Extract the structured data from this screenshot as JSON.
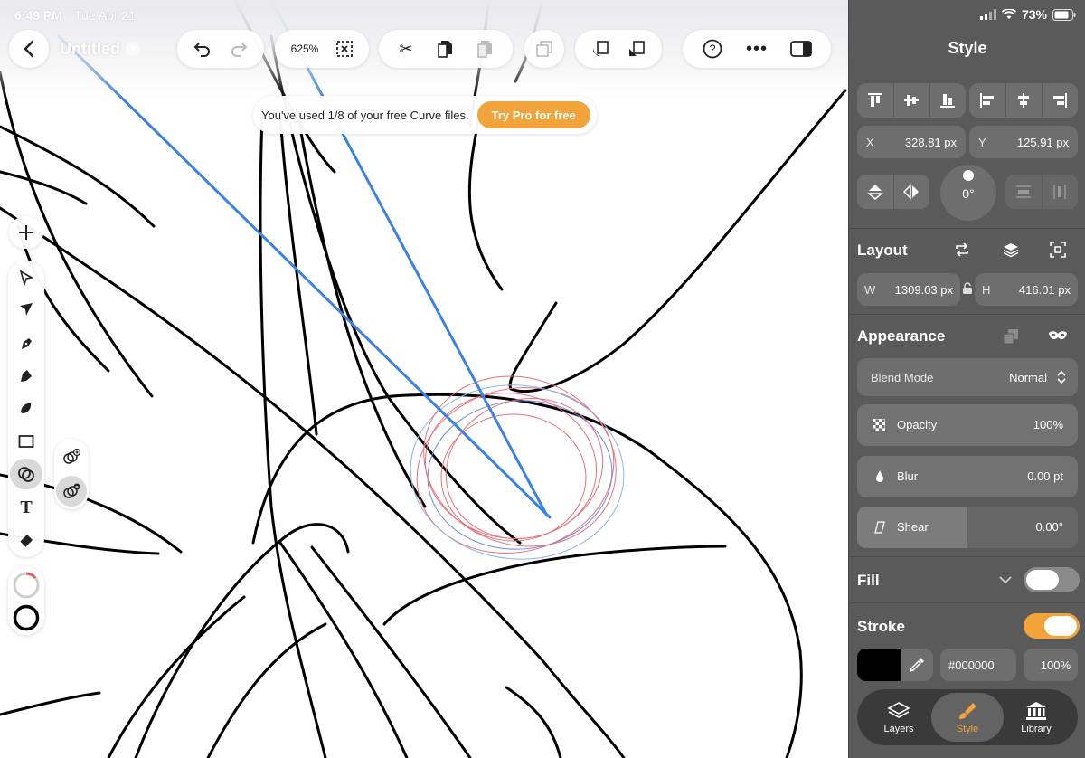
{
  "status": {
    "time": "6:49 PM",
    "date": "Tue Apr 21",
    "battery": "73%"
  },
  "document": {
    "title": "Untitled"
  },
  "toolbar": {
    "zoom": "625%",
    "buttons": [
      "undo",
      "redo",
      "zoom",
      "deselect",
      "cut",
      "copy",
      "paste",
      "duplicate",
      "bring-forward",
      "send-backward",
      "help",
      "more",
      "toggle-panel"
    ]
  },
  "banner": {
    "text": "You've used 1/8 of your free Curve files.",
    "cta": "Try Pro for free"
  },
  "left_tools": [
    "select",
    "direct-select",
    "pen",
    "pencil",
    "brush",
    "rectangle",
    "shape-builder",
    "text",
    "eraser"
  ],
  "shape_builder_sub": [
    "merge-shapes",
    "subtract-shapes"
  ],
  "panel": {
    "title": "Style",
    "position": {
      "x_label": "X",
      "x_value": "328.81 px",
      "y_label": "Y",
      "y_value": "125.91 px"
    },
    "rotation": "0°",
    "layout": {
      "title": "Layout",
      "w_label": "W",
      "w_value": "1309.03 px",
      "h_label": "H",
      "h_value": "416.01 px"
    },
    "appearance": {
      "title": "Appearance",
      "blend_mode_label": "Blend Mode",
      "blend_mode_value": "Normal",
      "opacity_label": "Opacity",
      "opacity_value": "100%",
      "blur_label": "Blur",
      "blur_value": "0.00 pt",
      "shear_label": "Shear",
      "shear_value": "0.00°"
    },
    "fill": {
      "title": "Fill",
      "enabled": false
    },
    "stroke": {
      "title": "Stroke",
      "enabled": true,
      "color": "#000000",
      "hex": "#000000",
      "opacity": "100%"
    }
  },
  "tabs": [
    {
      "label": "Layers",
      "active": false
    },
    {
      "label": "Style",
      "active": true
    },
    {
      "label": "Library",
      "active": false
    }
  ],
  "colors": {
    "accent": "#f2a33a",
    "panel_bg": "#5a5a5a",
    "selection_blue": "#3b82e6"
  }
}
